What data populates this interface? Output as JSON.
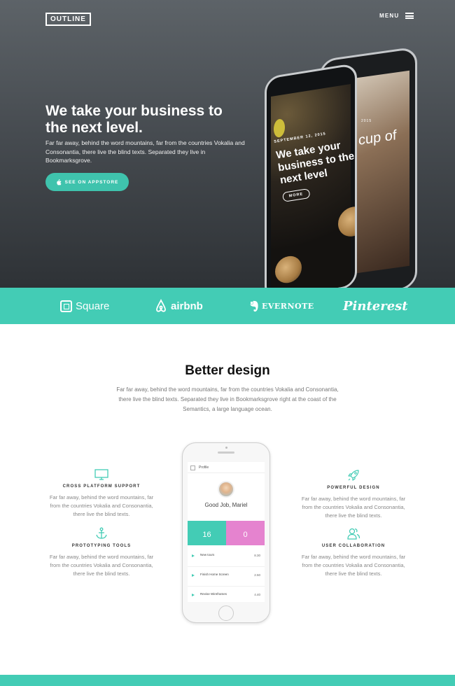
{
  "header": {
    "logo": "OUTLINE",
    "menu_label": "MENU"
  },
  "hero": {
    "title": "We take your business to the next level.",
    "description": "Far far away, behind the word mountains, far from the countries Vokalia and Consonantia, there live the blind texts. Separated they live in Bookmarksgrove.",
    "cta_label": "SEE ON APPSTORE"
  },
  "hero_phone": {
    "date": "SEPTEMBER 12, 2015",
    "title": "We take your business to the next level",
    "more_label": "MORE",
    "back_text": "cup of",
    "back_date": "2015"
  },
  "brands": [
    "Square",
    "airbnb",
    "EVERNOTE",
    "Pinterest"
  ],
  "features_section": {
    "title": "Better design",
    "description": "Far far away, behind the word mountains, far from the countries Vokalia and Consonantia, there live the blind texts. Separated they live in Bookmarksgrove right at the coast of the Semantics, a large language ocean.",
    "items": [
      {
        "icon": "monitor-icon",
        "title": "CROSS PLATFORM SUPPORT",
        "text": "Far far away, behind the word mountains, far from the countries Vokalia and Consonantia, there live the blind texts."
      },
      {
        "icon": "anchor-icon",
        "title": "PROTOTYPING TOOLS",
        "text": "Far far away, behind the word mountains, far from the countries Vokalia and Consonantia, there live the blind texts."
      },
      {
        "icon": "rocket-icon",
        "title": "POWERFUL DESIGN",
        "text": "Far far away, behind the word mountains, far from the countries Vokalia and Consonantia, there live the blind texts."
      },
      {
        "icon": "users-icon",
        "title": "USER COLLABORATION",
        "text": "Far far away, behind the word mountains, far from the countries Vokalia and Consonantia, there live the blind texts."
      }
    ]
  },
  "app_screen": {
    "header": "Profile",
    "greeting": "Good Job, Mariel",
    "tiles": [
      {
        "value": "16"
      },
      {
        "value": "0"
      }
    ],
    "list": [
      {
        "name": "New tours",
        "time": "8.30"
      },
      {
        "name": "Finish Home Screen",
        "time": "2.50"
      },
      {
        "name": "Revise Wireframes",
        "time": "4.40"
      }
    ]
  },
  "colors": {
    "accent": "#43ccb5",
    "pink": "#e583cf",
    "hero_dark": "#2e3236"
  }
}
